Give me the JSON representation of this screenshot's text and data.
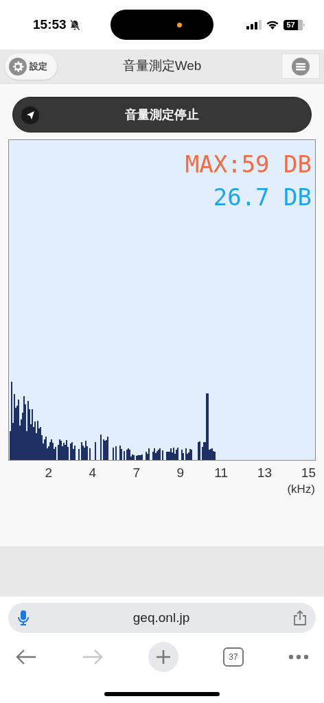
{
  "status_bar": {
    "time": "15:53",
    "battery": "57"
  },
  "header": {
    "settings_label": "設定",
    "title": "音量測定Web"
  },
  "measure_button": {
    "label": "音量測定停止"
  },
  "meter": {
    "max_reading": "MAX:59 DB",
    "current_reading": "26.7 DB",
    "x_labels": [
      "2",
      "4",
      "7",
      "9",
      "11",
      "13",
      "15"
    ],
    "x_unit": "(kHz)"
  },
  "browser": {
    "url": "geq.onl.jp",
    "tab_count": "37"
  }
}
